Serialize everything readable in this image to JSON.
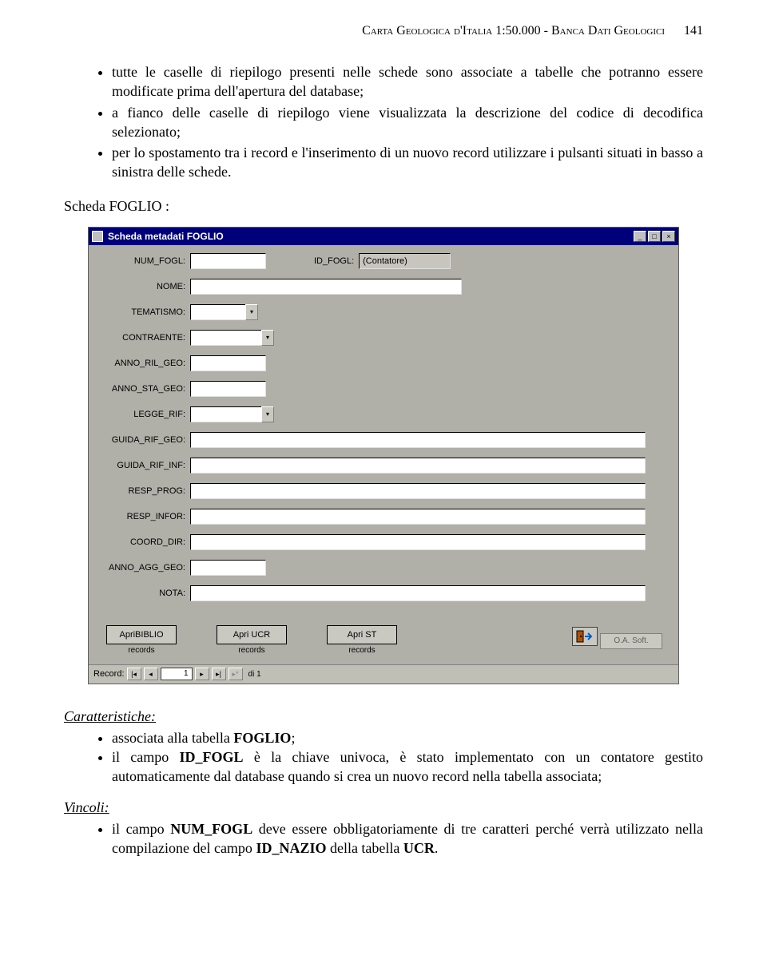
{
  "header": {
    "title_left": "Carta Geologica d'Italia 1:50.000 - Banca Dati Geologici",
    "page_number": "141"
  },
  "bullets": [
    "tutte le caselle di riepilogo presenti nelle schede sono associate a tabelle che potranno essere modificate prima dell'apertura del database;",
    "a fianco delle caselle di riepilogo viene visualizzata la descrizione del codice di decodifica selezionato;",
    "per lo spostamento tra i record e l'inserimento di un nuovo record utilizzare i pulsanti situati in basso a sinistra delle schede."
  ],
  "section_label": "Scheda FOGLIO :",
  "dialog": {
    "title": "Scheda metadati FOGLIO",
    "fields": {
      "num_fogl": {
        "label": "NUM_FOGL:",
        "value": ""
      },
      "id_fogl": {
        "label": "ID_FOGL:",
        "value": "(Contatore)"
      },
      "nome": {
        "label": "NOME:",
        "value": ""
      },
      "tematismo": {
        "label": "TEMATISMO:",
        "value": ""
      },
      "contraente": {
        "label": "CONTRAENTE:",
        "value": ""
      },
      "anno_ril_geo": {
        "label": "ANNO_RIL_GEO:",
        "value": ""
      },
      "anno_sta_geo": {
        "label": "ANNO_STA_GEO:",
        "value": ""
      },
      "legge_rif": {
        "label": "LEGGE_RIF:",
        "value": ""
      },
      "guida_rif_geo": {
        "label": "GUIDA_RIF_GEO:",
        "value": ""
      },
      "guida_rif_inf": {
        "label": "GUIDA_RIF_INF:",
        "value": ""
      },
      "resp_prog": {
        "label": "RESP_PROG:",
        "value": ""
      },
      "resp_infor": {
        "label": "RESP_INFOR:",
        "value": ""
      },
      "coord_dir": {
        "label": "COORD_DIR:",
        "value": ""
      },
      "anno_agg_geo": {
        "label": "ANNO_AGG_GEO:",
        "value": ""
      },
      "nota": {
        "label": "NOTA:",
        "value": ""
      }
    },
    "buttons": {
      "apri_biblio": "ApriBIBLIO",
      "apri_ucr": "Apri UCR",
      "apri_st": "Apri ST",
      "records": "records",
      "oa_soft": "O.A. Soft."
    },
    "nav": {
      "label": "Record:",
      "current": "1",
      "total": "di 1"
    }
  },
  "caratteristiche": {
    "heading": "Caratteristiche:",
    "items": [
      "associata alla tabella <b>FOGLIO</b>;",
      "il campo <b>ID_FOGL</b> è la chiave univoca, è stato implementato con un contatore gestito automaticamente dal database quando si crea un nuovo record nella tabella associata;"
    ]
  },
  "vincoli": {
    "heading": "Vincoli:",
    "items": [
      "il campo <b>NUM_FOGL</b> deve essere obbligatoriamente di tre caratteri perché verrà utilizzato nella compilazione del campo <b>ID_NAZIO</b> della tabella <b>UCR</b>."
    ]
  }
}
